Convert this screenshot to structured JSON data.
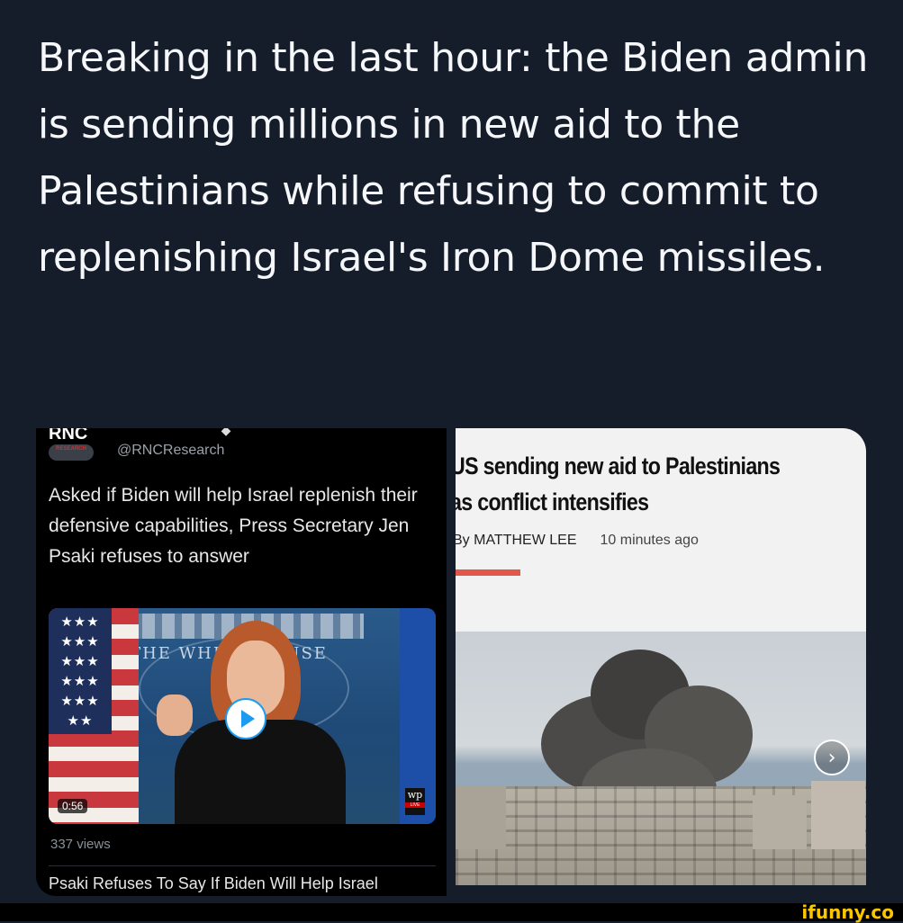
{
  "tweet": {
    "text": "Breaking in the last hour: the Biden admin is sending millions in new aid to the Palestinians while refusing to commit to replenishing Israel's Iron Dome missiles."
  },
  "embedded_tweet": {
    "logo_text": "RNC",
    "logo_subtext": "RESEARCH",
    "handle": "@RNCResearch",
    "text": "Asked if Biden will help Israel replenish their defensive capabilities, Press Secretary Jen Psaki refuses to answer",
    "video": {
      "backdrop_text": "THE WHITE HOUSE",
      "duration": "0:56",
      "badge": "wp",
      "badge_sub": "LIVE",
      "play_icon": "play-icon"
    },
    "views": "337 views",
    "video_title": "Psaki Refuses To Say If Biden Will Help Israel"
  },
  "article": {
    "headline_line1": "US sending new aid to Palestinians",
    "headline_line2": "as conflict intensifies",
    "byline": "By MATTHEW LEE",
    "time": "10 minutes ago",
    "accent_color": "#e1574a",
    "next_icon": "chevron-right-icon",
    "next_glyph": "›"
  },
  "watermark": {
    "text": "ifunny.co",
    "color": "#f9c600"
  }
}
